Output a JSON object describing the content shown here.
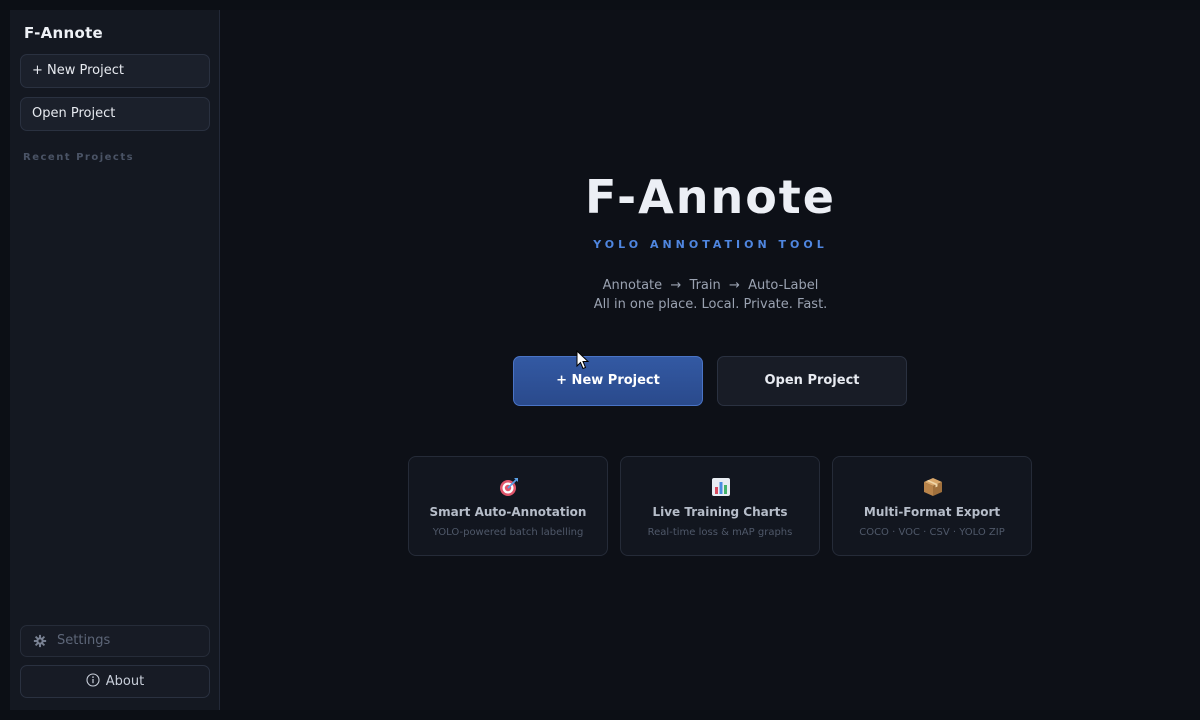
{
  "sidebar": {
    "app_title": "F-Annote",
    "new_project_label": "+ New Project",
    "open_project_label": "Open Project",
    "recent_section_label": "Recent Projects",
    "settings_label": "Settings",
    "about_label": "About"
  },
  "hero": {
    "title": "F-Annote",
    "subtitle": "YOLO ANNOTATION TOOL",
    "line1": "Annotate  →  Train  →  Auto-Label",
    "line2": "All in one place. Local. Private. Fast."
  },
  "actions": {
    "new_project_label": "+ New Project",
    "open_project_label": "Open Project"
  },
  "features": [
    {
      "icon": "target-icon",
      "title": "Smart Auto-Annotation",
      "desc": "YOLO-powered batch labelling"
    },
    {
      "icon": "bar-chart-icon",
      "title": "Live Training Charts",
      "desc": "Real-time loss & mAP graphs"
    },
    {
      "icon": "package-icon",
      "title": "Multi-Format Export",
      "desc": "COCO · VOC · CSV · YOLO ZIP"
    }
  ],
  "colors": {
    "accent": "#4f86e0",
    "primary_button": "#2f52a0",
    "background": "#0d1017",
    "sidebar": "#141821"
  }
}
